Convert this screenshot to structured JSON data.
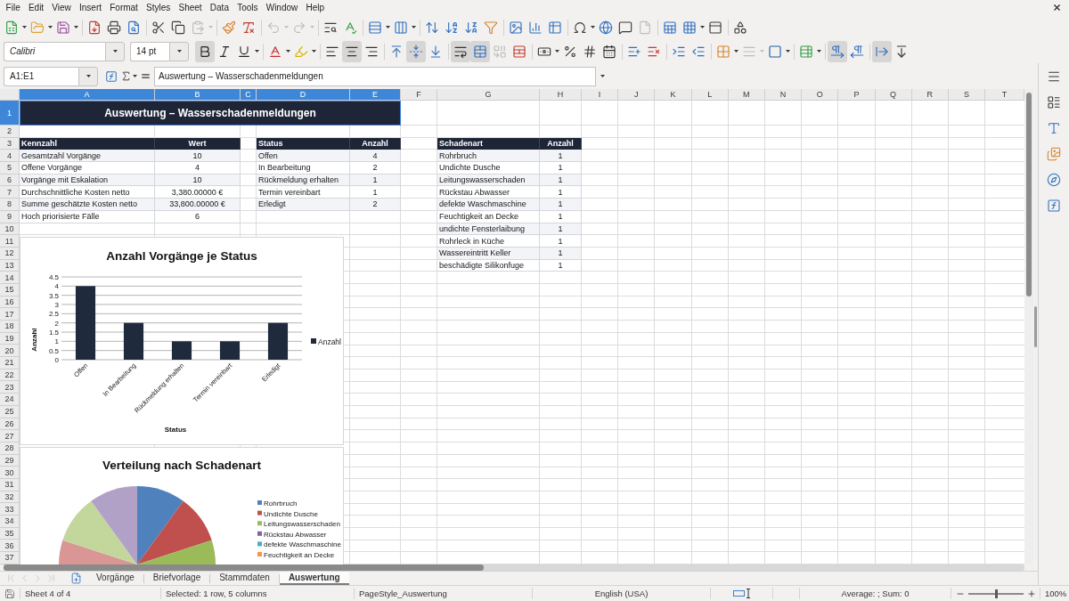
{
  "menu_bar": {
    "items": [
      "File",
      "Edit",
      "View",
      "Insert",
      "Format",
      "Styles",
      "Sheet",
      "Data",
      "Tools",
      "Window",
      "Help"
    ]
  },
  "standard_toolbar": {
    "buttons": [
      {
        "disabled": false
      },
      {
        "disabled": false
      },
      {
        "disabled": false
      },
      {
        "disabled": false
      },
      {
        "disabled": false
      },
      {
        "disabled": false
      },
      {
        "disabled": false
      },
      {
        "disabled": false
      },
      {
        "disabled": true
      },
      {
        "disabled": false
      },
      {
        "disabled": false
      },
      {
        "disabled": true
      },
      {
        "disabled": true
      },
      {
        "disabled": false
      },
      {
        "disabled": false
      },
      {
        "disabled": false
      },
      {
        "disabled": false
      },
      {
        "disabled": false
      },
      {
        "disabled": false
      },
      {
        "disabled": false
      },
      {
        "disabled": false
      },
      {
        "disabled": false
      },
      {
        "disabled": false
      },
      {
        "disabled": false
      },
      {
        "disabled": false
      },
      {
        "disabled": false
      },
      {
        "disabled": false
      },
      {
        "disabled": true
      },
      {
        "disabled": false
      },
      {
        "disabled": false
      },
      {
        "disabled": false
      },
      {
        "disabled": false
      }
    ]
  },
  "formatting_toolbar": {
    "font_name": "Calibri",
    "font_size": "14 pt",
    "buttons": [
      {
        "pressed": true,
        "disabled": false
      },
      {
        "pressed": false,
        "disabled": false
      },
      {
        "pressed": false,
        "disabled": false
      },
      {
        "pressed": false,
        "disabled": false
      },
      {
        "pressed": false,
        "disabled": false
      },
      {
        "pressed": false,
        "disabled": false
      },
      {
        "pressed": true,
        "disabled": false
      },
      {
        "pressed": false,
        "disabled": false
      },
      {
        "pressed": false,
        "disabled": false
      },
      {
        "pressed": true,
        "disabled": false
      },
      {
        "pressed": false,
        "disabled": false
      },
      {
        "pressed": true,
        "disabled": false
      },
      {
        "pressed": true,
        "disabled": false
      },
      {
        "pressed": false,
        "disabled": true
      },
      {
        "pressed": false,
        "disabled": false
      },
      {
        "pressed": false,
        "disabled": false
      },
      {
        "pressed": false,
        "disabled": false
      },
      {
        "pressed": false,
        "disabled": false
      },
      {
        "pressed": false,
        "disabled": false
      },
      {
        "pressed": false,
        "disabled": false
      },
      {
        "pressed": false,
        "disabled": false
      },
      {
        "pressed": false,
        "disabled": false
      },
      {
        "pressed": false,
        "disabled": false
      },
      {
        "pressed": false,
        "disabled": false
      },
      {
        "pressed": false,
        "disabled": true
      },
      {
        "pressed": false,
        "disabled": false
      },
      {
        "pressed": false,
        "disabled": false
      },
      {
        "pressed": true,
        "disabled": false
      },
      {
        "pressed": false,
        "disabled": false
      },
      {
        "pressed": true,
        "disabled": false
      },
      {
        "pressed": false,
        "disabled": false
      }
    ]
  },
  "formula_bar": {
    "name_box": "A1:E1",
    "content": "Auswertung – Wasserschadenmeldungen"
  },
  "sheet": {
    "columns": [
      {
        "label": "A",
        "selected": true
      },
      {
        "label": "B",
        "selected": true
      },
      {
        "label": "C",
        "selected": true
      },
      {
        "label": "D",
        "selected": true
      },
      {
        "label": "E",
        "selected": true
      },
      {
        "label": "F",
        "selected": false
      },
      {
        "label": "G",
        "selected": false
      },
      {
        "label": "H",
        "selected": false
      },
      {
        "label": "I",
        "selected": false
      },
      {
        "label": "J",
        "selected": false
      },
      {
        "label": "K",
        "selected": false
      },
      {
        "label": "L",
        "selected": false
      },
      {
        "label": "M",
        "selected": false
      },
      {
        "label": "N",
        "selected": false
      },
      {
        "label": "O",
        "selected": false
      },
      {
        "label": "P",
        "selected": false
      },
      {
        "label": "Q",
        "selected": false
      },
      {
        "label": "R",
        "selected": false
      },
      {
        "label": "S",
        "selected": false
      },
      {
        "label": "T",
        "selected": false
      }
    ],
    "rows": [
      {
        "label": "1",
        "selected": true
      },
      {
        "label": "2",
        "selected": false
      },
      {
        "label": "3",
        "selected": false
      },
      {
        "label": "4",
        "selected": false
      },
      {
        "label": "5",
        "selected": false
      },
      {
        "label": "6",
        "selected": false
      },
      {
        "label": "7",
        "selected": false
      },
      {
        "label": "8",
        "selected": false
      },
      {
        "label": "9",
        "selected": false
      },
      {
        "label": "10",
        "selected": false
      },
      {
        "label": "11",
        "selected": false
      },
      {
        "label": "12",
        "selected": false
      },
      {
        "label": "13",
        "selected": false
      },
      {
        "label": "14",
        "selected": false
      },
      {
        "label": "15",
        "selected": false
      },
      {
        "label": "16",
        "selected": false
      },
      {
        "label": "17",
        "selected": false
      },
      {
        "label": "18",
        "selected": false
      },
      {
        "label": "19",
        "selected": false
      },
      {
        "label": "20",
        "selected": false
      },
      {
        "label": "21",
        "selected": false
      },
      {
        "label": "22",
        "selected": false
      },
      {
        "label": "23",
        "selected": false
      },
      {
        "label": "24",
        "selected": false
      },
      {
        "label": "25",
        "selected": false
      },
      {
        "label": "26",
        "selected": false
      },
      {
        "label": "27",
        "selected": false
      },
      {
        "label": "28",
        "selected": false
      },
      {
        "label": "29",
        "selected": false
      },
      {
        "label": "30",
        "selected": false
      },
      {
        "label": "31",
        "selected": false
      },
      {
        "label": "32",
        "selected": false
      },
      {
        "label": "33",
        "selected": false
      },
      {
        "label": "34",
        "selected": false
      },
      {
        "label": "35",
        "selected": false
      },
      {
        "label": "36",
        "selected": false
      },
      {
        "label": "37",
        "selected": false
      }
    ],
    "title": {
      "text": "Auswertung – Wasserschadenmeldungen",
      "selected": true
    },
    "kpi_table": {
      "columns": [
        "Kennzahl",
        "Wert"
      ],
      "rows": [
        {
          "name": "Gesamtzahl Vorgänge",
          "value": "10"
        },
        {
          "name": "Offene Vorgänge",
          "value": "4"
        },
        {
          "name": "Vorgänge mit Eskalation",
          "value": "10"
        },
        {
          "name": "Durchschnittliche Kosten netto",
          "value": "3,380.00000 €"
        },
        {
          "name": "Summe geschätzte Kosten netto",
          "value": "33,800.00000 €"
        },
        {
          "name": "Hoch priorisierte Fälle",
          "value": "6"
        }
      ]
    },
    "status_table": {
      "columns": [
        "Status",
        "Anzahl"
      ],
      "rows": [
        {
          "name": "Offen",
          "value": "4"
        },
        {
          "name": "In Bearbeitung",
          "value": "2"
        },
        {
          "name": "Rückmeldung erhalten",
          "value": "1"
        },
        {
          "name": "Termin vereinbart",
          "value": "1"
        },
        {
          "name": "Erledigt",
          "value": "2"
        }
      ]
    },
    "damage_table": {
      "columns": [
        "Schadenart",
        "Anzahl"
      ],
      "rows": [
        {
          "name": "Rohrbruch",
          "value": "1"
        },
        {
          "name": "Undichte Dusche",
          "value": "1"
        },
        {
          "name": "Leitungswasserschaden",
          "value": "1"
        },
        {
          "name": "Rückstau Abwasser",
          "value": "1"
        },
        {
          "name": "defekte Waschmaschine",
          "value": "1"
        },
        {
          "name": "Feuchtigkeit an Decke",
          "value": "1"
        },
        {
          "name": "undichte Fensterlaibung",
          "value": "1"
        },
        {
          "name": "Rohrleck in Küche",
          "value": "1"
        },
        {
          "name": "Wassereintritt Keller",
          "value": "1"
        },
        {
          "name": "beschädigte Silikonfuge",
          "value": "1"
        }
      ]
    }
  },
  "bar_chart": {
    "chart_data": {
      "type": "bar",
      "title": "Anzahl Vorgänge je Status",
      "xlabel": "Status",
      "ylabel": "Anzahl",
      "categories": [
        "Offen",
        "In Bearbeitung",
        "Rückmeldung erhalten",
        "Termin vereinbart",
        "Erledigt"
      ],
      "series": [
        {
          "name": "Anzahl",
          "color": "#1f2a3c",
          "values": [
            4,
            2,
            1,
            1,
            2
          ]
        }
      ],
      "ylim": [
        0,
        4.5
      ],
      "yticks": [
        0,
        0.5,
        1,
        1.5,
        2,
        2.5,
        3,
        3.5,
        4,
        4.5
      ],
      "grid": true
    }
  },
  "pie_chart": {
    "title": "Verteilung nach Schadenart",
    "legend": [
      {
        "label": "Rohrbruch",
        "color": "#4f81bd"
      },
      {
        "label": "Undichte Dusche",
        "color": "#c0504d"
      },
      {
        "label": "Leitungswasserschaden",
        "color": "#9bbb59"
      },
      {
        "label": "Rückstau Abwasser",
        "color": "#8064a2"
      },
      {
        "label": "defekte Waschmaschine",
        "color": "#4bacc6"
      },
      {
        "label": "Feuchtigkeit an Decke",
        "color": "#f79646"
      }
    ]
  },
  "sheet_navigation": [
    {
      "disabled": true
    },
    {
      "disabled": true
    },
    {
      "disabled": true
    },
    {
      "disabled": true
    }
  ],
  "sheet_tabs": [
    {
      "label": "Vorgänge",
      "selected": false
    },
    {
      "label": "Briefvorlage",
      "selected": false
    },
    {
      "label": "Stammdaten",
      "selected": false
    },
    {
      "label": "Auswertung",
      "selected": true
    }
  ],
  "status_bar": {
    "sheet": "Sheet 4 of 4",
    "selection": "Selected: 1 row, 5 columns",
    "page_style": "PageStyle_Auswertung",
    "language": "English (USA)",
    "summary": "Average: ; Sum: 0",
    "zoom": {
      "level": 0.5,
      "reading": "100%"
    }
  }
}
